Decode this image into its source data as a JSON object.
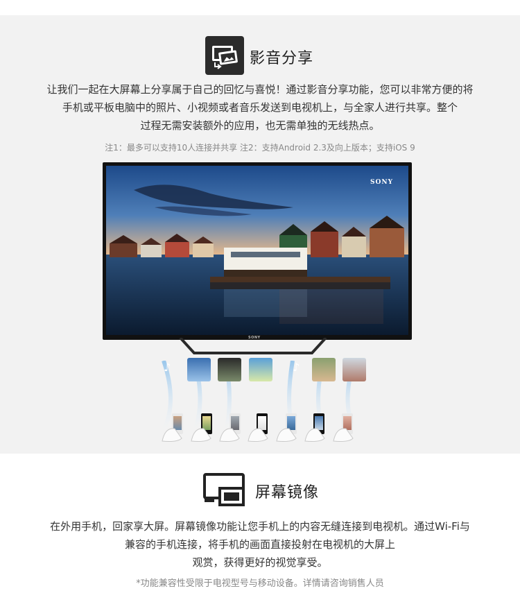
{
  "section1": {
    "icon": "media-share-icon",
    "title": "影音分享",
    "paragraph_lines": [
      "让我们一起在大屏幕上分享属于自己的回忆与喜悦！通过影音分享功能，您可以非常方便的将",
      "手机或平板电脑中的照片、小视频或者音乐发送到电视机上，与全家人进行共享。整个",
      "过程无需安装额外的应用，也无需单独的无线热点。"
    ],
    "note": "注1：最多可以支持10人连接并共享 注2：支持Android 2.3及向上版本；支持iOS 9",
    "tv_brand": "SONY",
    "tv_bottom_brand": "SONY"
  },
  "section2": {
    "icon": "screen-mirror-icon",
    "title": "屏幕镜像",
    "paragraph_lines": [
      "在外用手机，回家享大屏。屏幕镜像功能让您手机上的内容无缝连接到电视机。通过Wi-Fi与",
      "兼容的手机连接，将手机的画面直接投射在电视机的大屏上",
      "观赏，获得更好的视觉享受。"
    ],
    "note": "*功能兼容性受限于电视型号与移动设备。详情请咨询销售人员"
  },
  "colors": {
    "band_bg": "#f2f2f2",
    "signal_blue": "#cfe3f5",
    "icon_dark": "#2b2b2b"
  },
  "music_glyph": "♪"
}
